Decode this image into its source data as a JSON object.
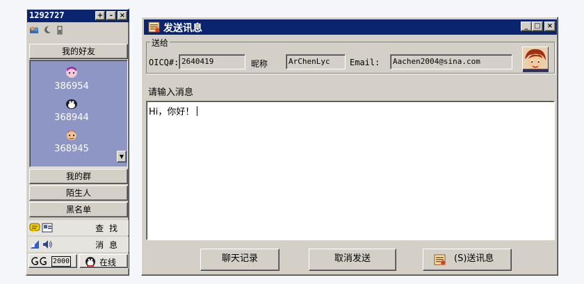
{
  "main_panel": {
    "uin": "1292727",
    "groups": {
      "friends": "我的好友",
      "my_groups": "我的群",
      "strangers": "陌生人",
      "blacklist": "黑名单"
    },
    "buddies": [
      {
        "number": "386954",
        "face": "girl-face-icon"
      },
      {
        "number": "368944",
        "face": "penguin-face-icon"
      },
      {
        "number": "368945",
        "face": "boy-face-icon"
      }
    ],
    "search_label": "查 找",
    "messages_label": "消 息",
    "brand_label": "2000",
    "status_label": "在线"
  },
  "message_window": {
    "title": "发送讯息",
    "send_to_legend": "送给",
    "oicq_label": "OICQ#:",
    "oicq_value": "2640419",
    "nickname_label": "昵称",
    "nickname_value": "ArChenLyc",
    "email_label": "Email:",
    "email_value": "Aachen2004@sina.com",
    "prompt": "请输入消息",
    "message_text": "Hi，你好！",
    "buttons": {
      "history": "聊天记录",
      "cancel": "取消发送",
      "send": "(S)送讯息"
    }
  },
  "colors": {
    "titlebar": "#0a2470",
    "friend_list_bg": "#8d96c4",
    "window_face": "#d4d0c8"
  }
}
